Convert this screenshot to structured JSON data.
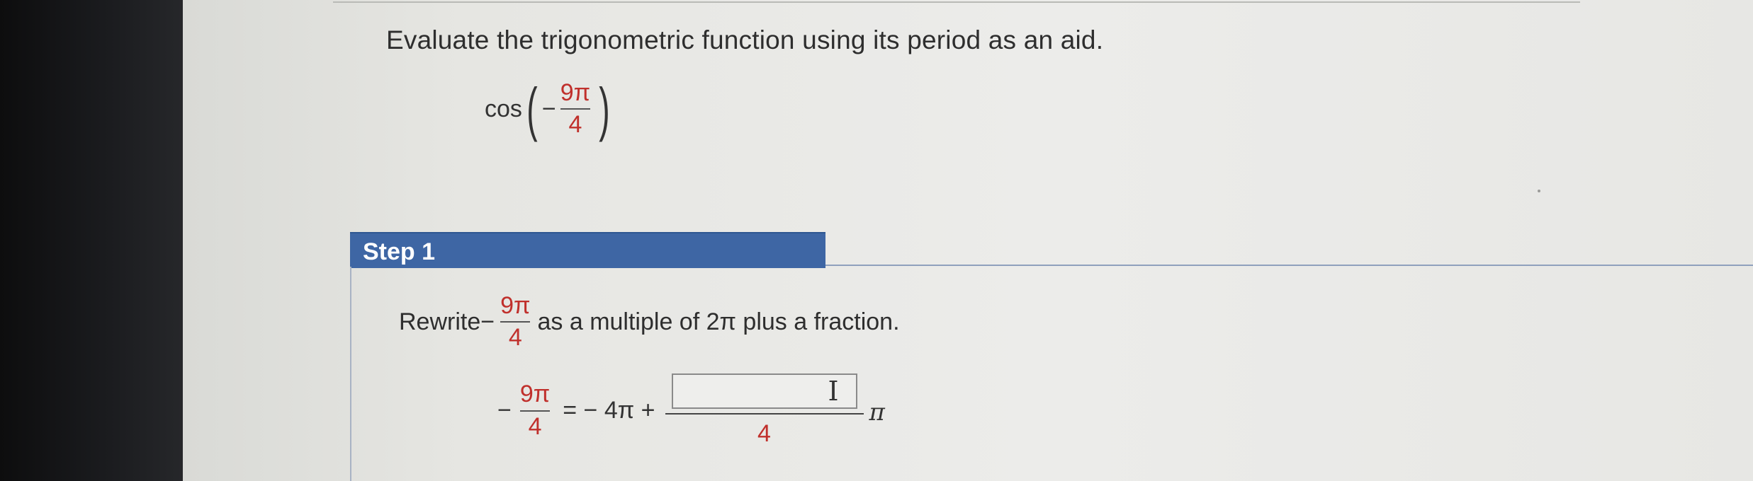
{
  "question": {
    "prompt": "Evaluate the trigonometric function using its period as an aid.",
    "expression": {
      "function": "cos",
      "sign": "−",
      "numerator": "9π",
      "denominator": "4"
    }
  },
  "step": {
    "label": "Step 1",
    "instruction_prefix": "Rewrite−",
    "instruction_numerator": "9π",
    "instruction_denominator": "4",
    "instruction_suffix": "as a multiple of 2π plus a fraction.",
    "equation": {
      "lhs_sign": "−",
      "lhs_numerator": "9π",
      "lhs_denominator": "4",
      "middle": "= − 4π +",
      "answer_value": "",
      "answer_denominator": "4",
      "trailing": "π"
    }
  },
  "colors": {
    "step_header": "#3e66a4",
    "fraction_red": "#c0302c"
  }
}
